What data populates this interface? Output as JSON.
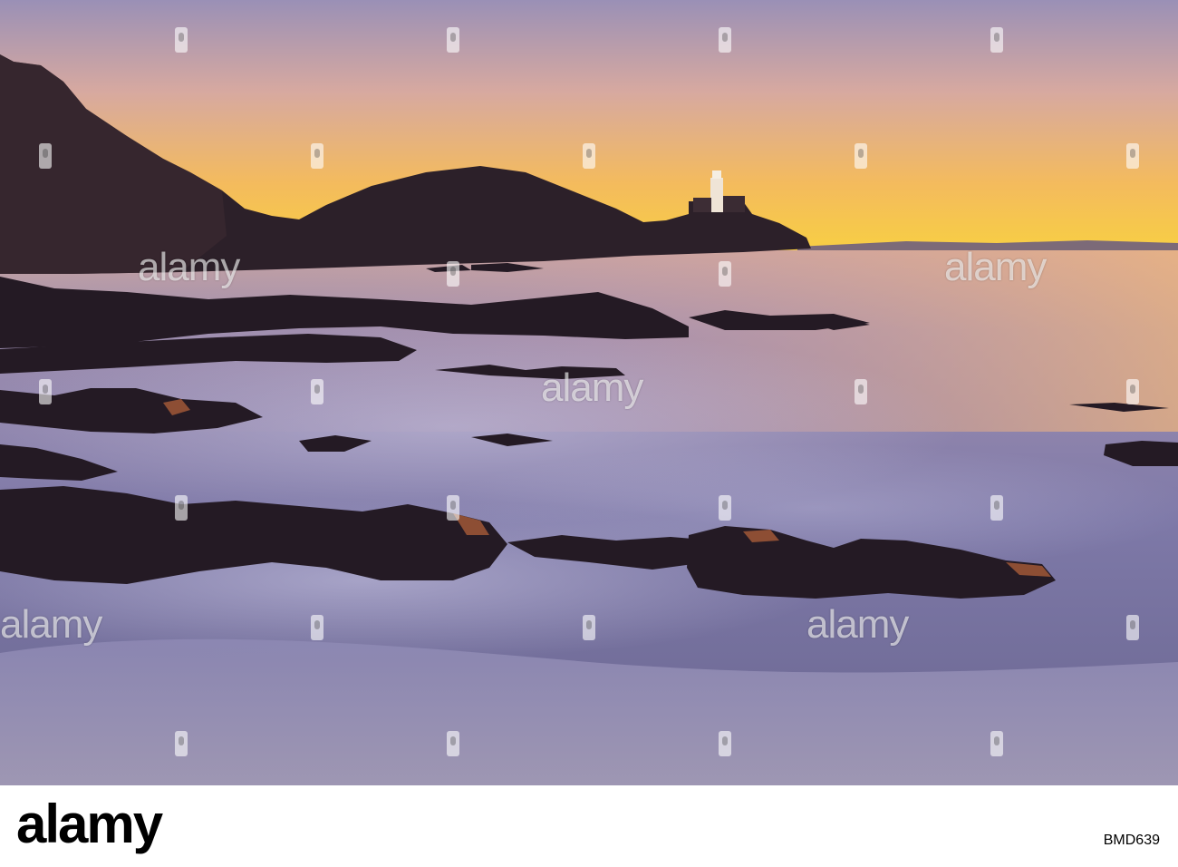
{
  "photo": {
    "subject": "coastline-at-sunrise-with-lighthouse",
    "colors": {
      "sky_top": "#9d92b4",
      "sky_mid": "#f1b86a",
      "sky_horizon": "#f7cf3d",
      "headland": "#2a1f27",
      "water": "#7c77a4",
      "foam": "#c7c3e0",
      "rocks": "#241a24",
      "rock_highlight": "#b0603a"
    }
  },
  "watermark": {
    "text": "alamy"
  },
  "footer": {
    "logo": "alamy",
    "image_id": "BMD639"
  }
}
